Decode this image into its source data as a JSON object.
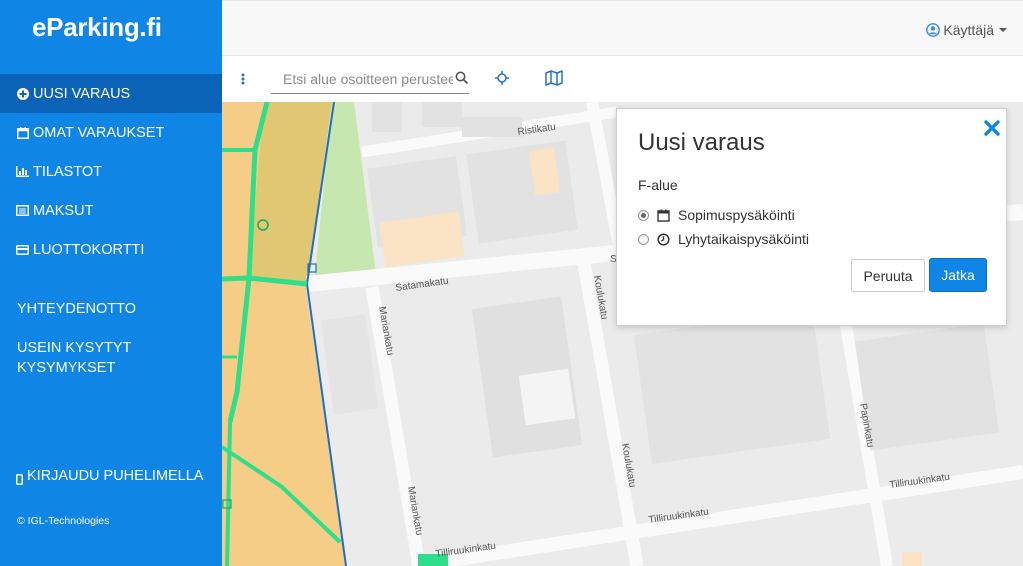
{
  "app": {
    "logo_text": "eParking.fi",
    "brand_color": "#0f86e6",
    "active_color": "#0a63b6"
  },
  "sidebar": {
    "items": [
      {
        "label": "UUSI VARAUS",
        "icon": "plus-circle-icon"
      },
      {
        "label": "OMAT VARAUKSET",
        "icon": "calendar-icon"
      },
      {
        "label": "TILASTOT",
        "icon": "bar-chart-icon"
      },
      {
        "label": "MAKSUT",
        "icon": "list-icon"
      },
      {
        "label": "LUOTTOKORTTI",
        "icon": "credit-card-icon"
      }
    ],
    "links": {
      "contact": "YHTEYDENOTTO",
      "faq_line1": "USEIN KYSYTYT",
      "faq_line2": "KYSYMYKSET"
    },
    "phone_login": "KIRJAUDU PUHELIMELLA",
    "copyright": "© IGL-Technologies"
  },
  "header": {
    "user_label": "Käyttäjä"
  },
  "toolbar": {
    "search_placeholder": "Etsi alue osoitteen perusteella"
  },
  "map": {
    "streets": [
      "Ristikatu",
      "Satamakatu",
      "Mariankatu",
      "Mariankatu",
      "Koulukatu",
      "Koulukatu",
      "Papinkatu",
      "Tilliruukinkatu",
      "Tilliruukinkatu",
      "Tilliruukinkatu",
      "S"
    ]
  },
  "modal": {
    "title": "Uusi varaus",
    "zone_label": "F-alue",
    "options": [
      {
        "label": "Sopimuspysäköinti",
        "checked": true,
        "icon": "calendar-icon"
      },
      {
        "label": "Lyhytaikaispysäköinti",
        "checked": false,
        "icon": "clock-icon"
      }
    ],
    "cancel_label": "Peruuta",
    "continue_label": "Jatka"
  }
}
